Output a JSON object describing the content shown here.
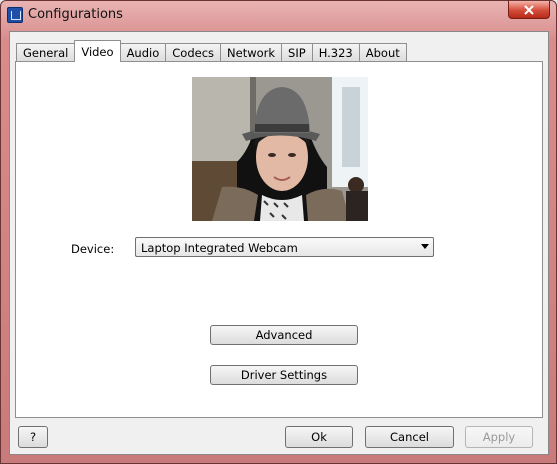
{
  "window": {
    "title": "Configurations",
    "close_icon": "close-icon"
  },
  "tabs": [
    {
      "label": "General"
    },
    {
      "label": "Video"
    },
    {
      "label": "Audio"
    },
    {
      "label": "Codecs"
    },
    {
      "label": "Network"
    },
    {
      "label": "SIP"
    },
    {
      "label": "H.323"
    },
    {
      "label": "About"
    }
  ],
  "active_tab": "Video",
  "video": {
    "device_label": "Device:",
    "device_value": "Laptop Integrated Webcam",
    "advanced_label": "Advanced",
    "driver_settings_label": "Driver Settings"
  },
  "footer": {
    "help_label": "?",
    "ok_label": "Ok",
    "cancel_label": "Cancel",
    "apply_label": "Apply"
  }
}
